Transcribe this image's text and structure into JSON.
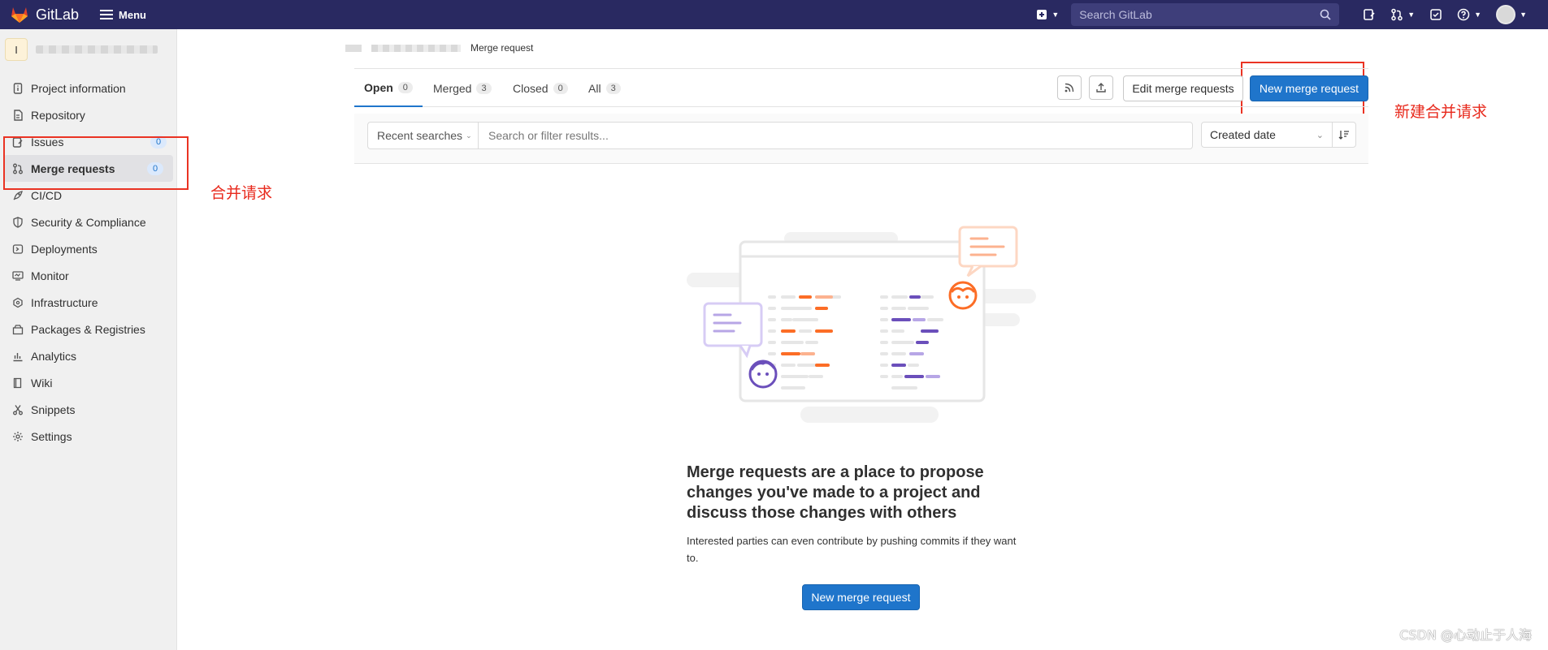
{
  "header": {
    "brand": "GitLab",
    "menu_label": "Menu",
    "search_placeholder": "Search GitLab",
    "icons": [
      "plus-square-icon",
      "search-icon",
      "issues-icon",
      "merge-request-icon",
      "todo-icon",
      "help-icon",
      "avatar"
    ]
  },
  "sidebar": {
    "project_letter": "I",
    "items": [
      {
        "label": "Project information",
        "icon": "info-icon"
      },
      {
        "label": "Repository",
        "icon": "doc-icon"
      },
      {
        "label": "Issues",
        "icon": "issues-icon",
        "count": "0"
      },
      {
        "label": "Merge requests",
        "icon": "merge-request-icon",
        "count": "0"
      },
      {
        "label": "CI/CD",
        "icon": "rocket-icon"
      },
      {
        "label": "Security & Compliance",
        "icon": "shield-icon"
      },
      {
        "label": "Deployments",
        "icon": "deployments-icon"
      },
      {
        "label": "Monitor",
        "icon": "monitor-icon"
      },
      {
        "label": "Infrastructure",
        "icon": "cloud-icon"
      },
      {
        "label": "Packages & Registries",
        "icon": "package-icon"
      },
      {
        "label": "Analytics",
        "icon": "chart-icon"
      },
      {
        "label": "Wiki",
        "icon": "book-icon"
      },
      {
        "label": "Snippets",
        "icon": "scissors-icon"
      },
      {
        "label": "Settings",
        "icon": "gear-icon"
      }
    ]
  },
  "breadcrumb": {
    "current": "Merge request"
  },
  "tabs": [
    {
      "label": "Open",
      "count": "0"
    },
    {
      "label": "Merged",
      "count": "3"
    },
    {
      "label": "Closed",
      "count": "0"
    },
    {
      "label": "All",
      "count": "3"
    }
  ],
  "actions": {
    "edit_label": "Edit merge requests",
    "new_label": "New merge request"
  },
  "filter": {
    "recent_label": "Recent searches",
    "placeholder": "Search or filter results...",
    "sort_label": "Created date"
  },
  "empty_state": {
    "title": "Merge requests are a place to propose changes you've made to a project and discuss those changes with others",
    "description": "Interested parties can even contribute by pushing commits if they want to.",
    "button_label": "New merge request"
  },
  "annotations": {
    "sidebar_note": "合并请求",
    "button_note": "新建合并请求",
    "color": "#ea3323"
  },
  "watermark": "CSDN @心动止于人海",
  "colors": {
    "header": "#292961",
    "primary": "#1f75cb",
    "accent_orange": "#fc6d26",
    "accent_purple": "#6b4fbb"
  }
}
